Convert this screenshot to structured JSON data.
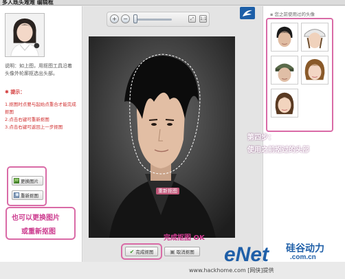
{
  "window": {
    "title": "多人既头难难 编辑框"
  },
  "left_panel": {
    "description": "说明：如上图，用抠图工具沿着头像外轮廓抠选出头部。",
    "tips_title": "提示：",
    "tips": [
      "1.抠图时点要与起始点重合才能完成抠图",
      "2.点击右键可重新抠图",
      "3.点击右键可返回上一步抠图"
    ],
    "buttons": {
      "change_image": "更换图片",
      "recrop": "重新抠图"
    },
    "annotation": {
      "line1": "也可以更换图片",
      "line2": "或重新抠图"
    }
  },
  "center": {
    "toolbar": {
      "zoom_in": "+",
      "zoom_out": "−",
      "slider_level": 0.05
    },
    "photo_tag": "重新抠图",
    "annotation": "完成抠图 OK",
    "buttons": {
      "done": "完成抠图",
      "cancel": "取消抠图"
    }
  },
  "right_panel": {
    "title": "您之前使用过的头像",
    "annotation": {
      "line1": "第四步：",
      "line2": "使用之前抠过的头部"
    }
  },
  "footer": {
    "url": "www.hackhome.com [网侠]提供",
    "logo_main": "eNet",
    "logo_sub": "硅谷动力",
    "logo_domain": ".com.cn"
  },
  "colors": {
    "annotation_pink": "#d96aa6",
    "annotation_text": "#cc3a8e",
    "tip_red": "#d03030",
    "logo_blue": "#1f5fa8"
  }
}
